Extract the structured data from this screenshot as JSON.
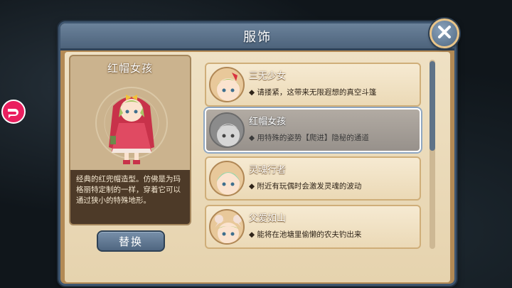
{
  "dialog": {
    "title": "服饰"
  },
  "selected_costume": {
    "name": "红帽女孩",
    "description": "经典的红兜帽造型。仿佛是为玛格丽特定制的一样，穿着它可以通过狭小的特殊地形。"
  },
  "buttons": {
    "swap_label": "替换"
  },
  "costumes": [
    {
      "name": "三无少女",
      "description": "◆ 请搂紧，这带来无限遐想的真空斗篷",
      "selected": false
    },
    {
      "name": "红帽女孩",
      "description": "◆ 用特殊的姿势【爬进】隐秘的通道",
      "selected": true
    },
    {
      "name": "灵魂行者",
      "description": "◆ 附近有玩偶时会激发灵魂的波动",
      "selected": false
    },
    {
      "name": "父爱如山",
      "description": "◆ 能将在池塘里偷懒的农夫钓出来",
      "selected": false
    }
  ],
  "colors": {
    "header": "#5a7089",
    "parchment": "#efe1c4",
    "side_badge": "#ea1f5f",
    "close_ring": "#e8c489"
  },
  "icons": [
    "close-icon",
    "side-app-icon"
  ]
}
